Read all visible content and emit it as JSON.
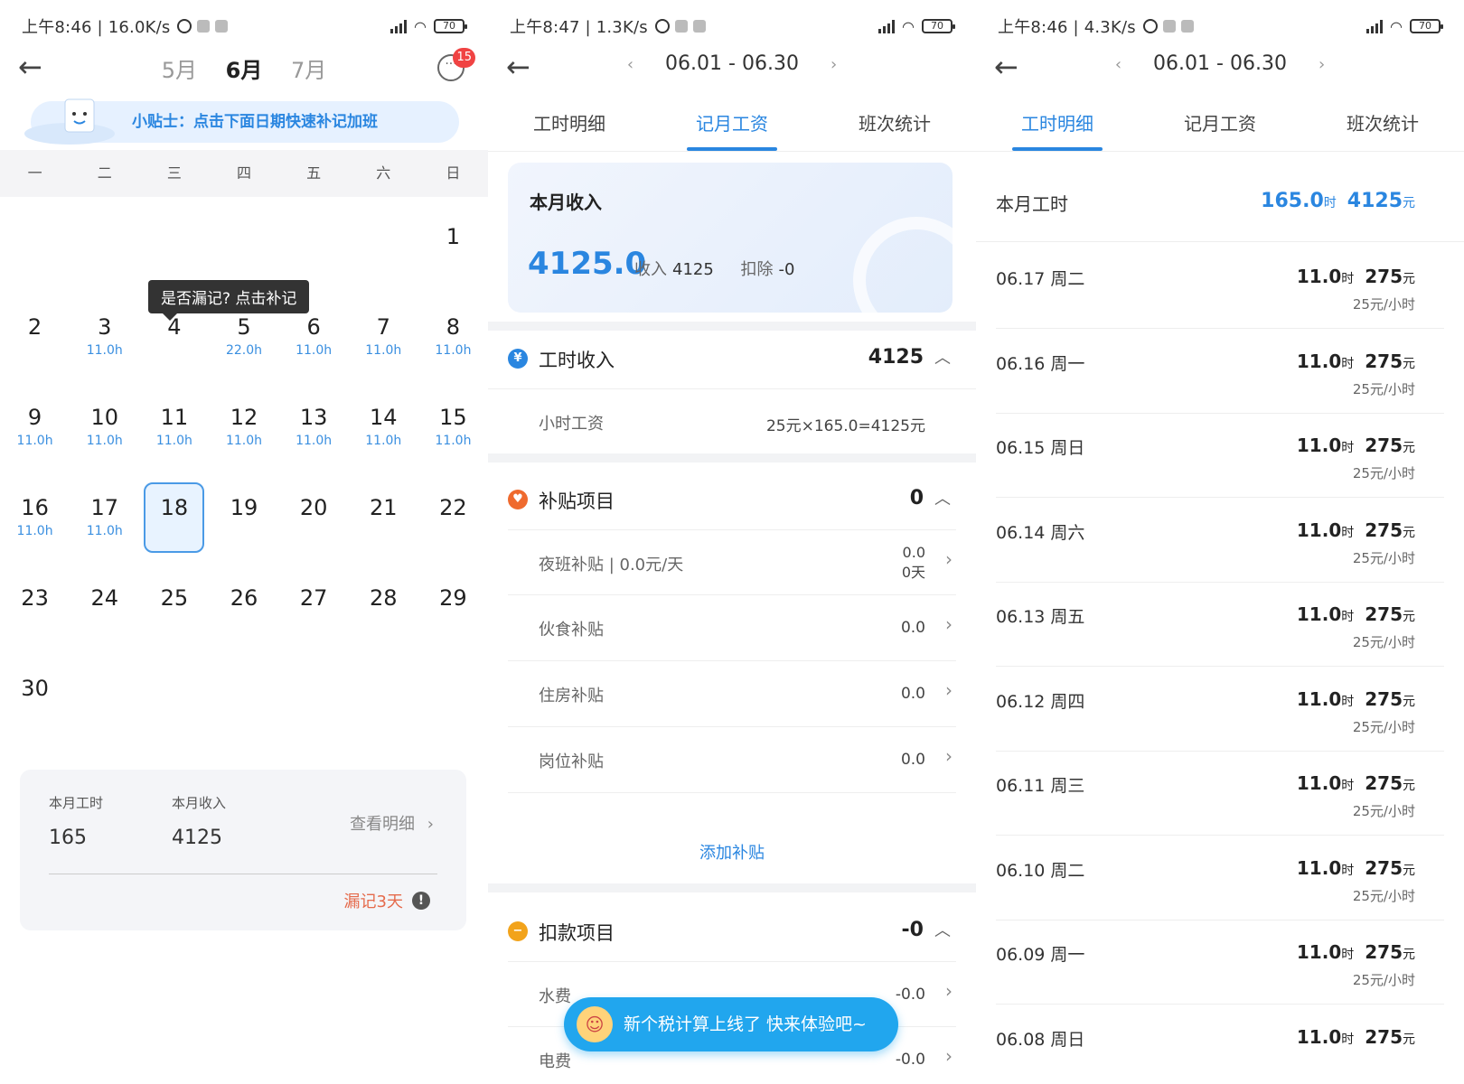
{
  "status": [
    {
      "text": "上午8:46 | 16.0K/s",
      "battery": "70"
    },
    {
      "text": "上午8:47 | 1.3K/s",
      "battery": "70"
    },
    {
      "text": "上午8:46 | 4.3K/s",
      "battery": "70"
    }
  ],
  "screen1": {
    "months": [
      "5月",
      "6月",
      "7月"
    ],
    "badge": "15",
    "tip": "小贴士：点击下面日期快速补记加班",
    "weekdays": [
      "一",
      "二",
      "三",
      "四",
      "五",
      "六",
      "日"
    ],
    "tooltip": "是否漏记? 点击补记",
    "weeks": [
      [
        {
          "d": "",
          "h": ""
        },
        {
          "d": "",
          "h": ""
        },
        {
          "d": "",
          "h": ""
        },
        {
          "d": "",
          "h": ""
        },
        {
          "d": "",
          "h": ""
        },
        {
          "d": "",
          "h": ""
        },
        {
          "d": "1",
          "h": ""
        }
      ],
      [
        {
          "d": "2",
          "h": ""
        },
        {
          "d": "3",
          "h": "11.0h"
        },
        {
          "d": "4",
          "h": ""
        },
        {
          "d": "5",
          "h": "22.0h"
        },
        {
          "d": "6",
          "h": "11.0h"
        },
        {
          "d": "7",
          "h": "11.0h"
        },
        {
          "d": "8",
          "h": "11.0h"
        }
      ],
      [
        {
          "d": "9",
          "h": "11.0h"
        },
        {
          "d": "10",
          "h": "11.0h"
        },
        {
          "d": "11",
          "h": "11.0h"
        },
        {
          "d": "12",
          "h": "11.0h"
        },
        {
          "d": "13",
          "h": "11.0h"
        },
        {
          "d": "14",
          "h": "11.0h"
        },
        {
          "d": "15",
          "h": "11.0h"
        }
      ],
      [
        {
          "d": "16",
          "h": "11.0h"
        },
        {
          "d": "17",
          "h": "11.0h"
        },
        {
          "d": "18",
          "h": "",
          "today": true
        },
        {
          "d": "19",
          "h": ""
        },
        {
          "d": "20",
          "h": ""
        },
        {
          "d": "21",
          "h": ""
        },
        {
          "d": "22",
          "h": ""
        }
      ],
      [
        {
          "d": "23",
          "h": ""
        },
        {
          "d": "24",
          "h": ""
        },
        {
          "d": "25",
          "h": ""
        },
        {
          "d": "26",
          "h": ""
        },
        {
          "d": "27",
          "h": ""
        },
        {
          "d": "28",
          "h": ""
        },
        {
          "d": "29",
          "h": ""
        }
      ],
      [
        {
          "d": "30",
          "h": ""
        },
        {
          "d": "",
          "h": ""
        },
        {
          "d": "",
          "h": ""
        },
        {
          "d": "",
          "h": ""
        },
        {
          "d": "",
          "h": ""
        },
        {
          "d": "",
          "h": ""
        },
        {
          "d": "",
          "h": ""
        }
      ]
    ],
    "summary": {
      "hours_label": "本月工时",
      "hours_value": "165",
      "income_label": "本月收入",
      "income_value": "4125",
      "detail_link": "查看明细",
      "missed": "漏记3天"
    }
  },
  "screen2": {
    "range": "06.01 - 06.30",
    "tabs": [
      "工时明细",
      "记月工资",
      "班次统计"
    ],
    "card": {
      "title": "本月收入",
      "total": "4125.0",
      "income_label": "收入",
      "income": "4125",
      "deduct_label": "扣除",
      "deduct": "-0"
    },
    "hour_income": {
      "title": "工时收入",
      "value": "4125",
      "rows": [
        {
          "label": "小时工资",
          "value": "25元×165.0=4125元"
        }
      ]
    },
    "allowance": {
      "title": "补贴项目",
      "value": "0",
      "rows": [
        {
          "label": "夜班补贴 | 0.0元/天",
          "value": "0.0",
          "sub": "0天"
        },
        {
          "label": "伙食补贴",
          "value": "0.0"
        },
        {
          "label": "住房补贴",
          "value": "0.0"
        },
        {
          "label": "岗位补贴",
          "value": "0.0"
        }
      ],
      "add": "添加补贴"
    },
    "deduction": {
      "title": "扣款项目",
      "value": "-0",
      "rows": [
        {
          "label": "水费",
          "value": "-0.0"
        },
        {
          "label": "电费",
          "value": "-0.0"
        }
      ]
    },
    "toast": "新个税计算上线了 快来体验吧~"
  },
  "screen3": {
    "range": "06.01 - 06.30",
    "tabs": [
      "工时明细",
      "记月工资",
      "班次统计"
    ],
    "month": {
      "label": "本月工时",
      "hours": "165.0",
      "hours_unit": "时",
      "money": "4125",
      "money_unit": "元"
    },
    "days": [
      {
        "date": "06.17 周二",
        "hours": "11.0",
        "money": "275",
        "rate": "25元/小时"
      },
      {
        "date": "06.16 周一",
        "hours": "11.0",
        "money": "275",
        "rate": "25元/小时"
      },
      {
        "date": "06.15 周日",
        "hours": "11.0",
        "money": "275",
        "rate": "25元/小时"
      },
      {
        "date": "06.14 周六",
        "hours": "11.0",
        "money": "275",
        "rate": "25元/小时"
      },
      {
        "date": "06.13 周五",
        "hours": "11.0",
        "money": "275",
        "rate": "25元/小时"
      },
      {
        "date": "06.12 周四",
        "hours": "11.0",
        "money": "275",
        "rate": "25元/小时"
      },
      {
        "date": "06.11 周三",
        "hours": "11.0",
        "money": "275",
        "rate": "25元/小时"
      },
      {
        "date": "06.10 周二",
        "hours": "11.0",
        "money": "275",
        "rate": "25元/小时"
      },
      {
        "date": "06.09 周一",
        "hours": "11.0",
        "money": "275",
        "rate": "25元/小时"
      },
      {
        "date": "06.08 周日",
        "hours": "11.0",
        "money": "275",
        "rate": ""
      }
    ],
    "hours_unit": "时",
    "money_unit": "元"
  },
  "colors": {
    "accent": "#2a86e0",
    "warning": "#e56b4c",
    "toast": "#21a6ee"
  },
  "icons": [
    "back-arrow-icon",
    "chat-icon",
    "chevron-right-icon",
    "chevron-left-icon",
    "chevron-up-icon",
    "alarm-icon",
    "wifi-icon",
    "signal-icon",
    "battery-icon",
    "yen-icon",
    "heart-icon",
    "minus-icon",
    "clock-icon"
  ]
}
